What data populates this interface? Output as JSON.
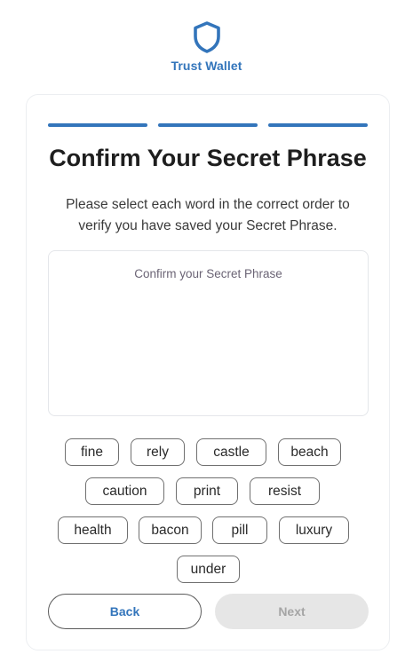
{
  "brand": {
    "name": "Trust Wallet",
    "icon": "shield-icon",
    "accent": "#3375bb"
  },
  "progress": {
    "steps_total": 3,
    "steps_complete": 3
  },
  "title": "Confirm Your Secret Phrase",
  "subtitle": "Please select each word in the correct order to verify you have saved your Secret Phrase.",
  "phrase_box": {
    "placeholder": "Confirm your Secret Phrase",
    "selected_words": []
  },
  "words": [
    "fine",
    "rely",
    "castle",
    "beach",
    "caution",
    "print",
    "resist",
    "health",
    "bacon",
    "pill",
    "luxury",
    "under"
  ],
  "buttons": {
    "back": "Back",
    "next": "Next",
    "next_enabled": false
  }
}
